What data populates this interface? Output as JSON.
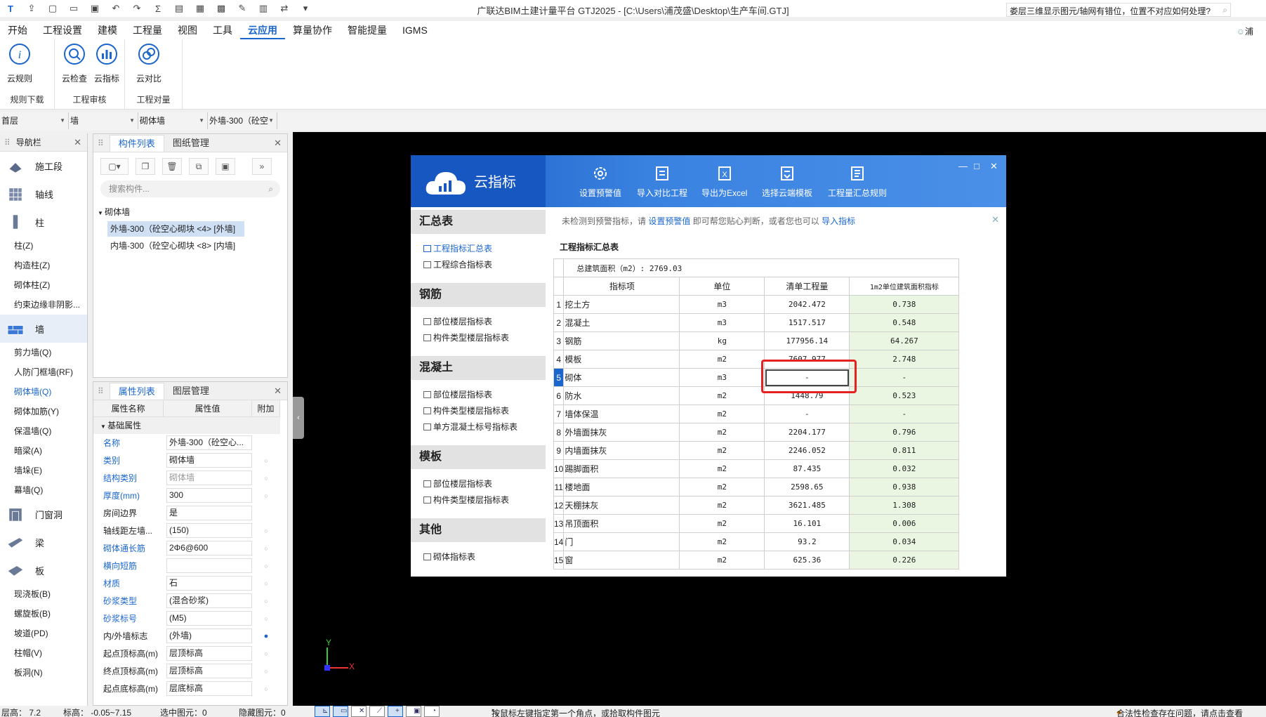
{
  "window": {
    "title": "广联达BIM土建计量平台 GTJ2025 - [C:\\Users\\浦茂盛\\Desktop\\生产车间.GTJ]"
  },
  "menu": {
    "items": [
      "开始",
      "工程设置",
      "建模",
      "工程量",
      "视图",
      "工具",
      "云应用",
      "算量协作",
      "智能提量",
      "IGMS"
    ],
    "active": "云应用",
    "help_search": "娄层三维显示图元/轴网有错位，位置不对应如何处理?",
    "user": "浦"
  },
  "ribbon": {
    "groups": [
      {
        "title": "规则下载",
        "buttons": [
          "云规则"
        ]
      },
      {
        "title": "工程审核",
        "buttons": [
          "云检查",
          "云指标"
        ]
      },
      {
        "title": "工程对量",
        "buttons": [
          "云对比"
        ]
      }
    ]
  },
  "selectors": [
    "首层",
    "墙",
    "砌体墙",
    "外墙-300（砼空"
  ],
  "nav": {
    "title": "导航栏",
    "entries": [
      {
        "type": "cat",
        "label": "施工段"
      },
      {
        "type": "cat",
        "label": "轴线"
      },
      {
        "type": "cat",
        "label": "柱"
      },
      {
        "type": "sub",
        "label": "柱(Z)"
      },
      {
        "type": "sub",
        "label": "构造柱(Z)"
      },
      {
        "type": "sub",
        "label": "砌体柱(Z)"
      },
      {
        "type": "sub",
        "label": "约束边缘非阴影..."
      },
      {
        "type": "cat",
        "label": "墙",
        "highlight": true
      },
      {
        "type": "sub",
        "label": "剪力墙(Q)"
      },
      {
        "type": "sub",
        "label": "人防门框墙(RF)"
      },
      {
        "type": "sub",
        "label": "砌体墙(Q)",
        "selected": true
      },
      {
        "type": "sub",
        "label": "砌体加筋(Y)"
      },
      {
        "type": "sub",
        "label": "保温墙(Q)"
      },
      {
        "type": "sub",
        "label": "暗梁(A)"
      },
      {
        "type": "sub",
        "label": "墙垛(E)"
      },
      {
        "type": "sub",
        "label": "幕墙(Q)"
      },
      {
        "type": "cat",
        "label": "门窗洞"
      },
      {
        "type": "cat",
        "label": "梁"
      },
      {
        "type": "cat",
        "label": "板"
      },
      {
        "type": "sub",
        "label": "现浇板(B)"
      },
      {
        "type": "sub",
        "label": "螺旋板(B)"
      },
      {
        "type": "sub",
        "label": "坡道(PD)"
      },
      {
        "type": "sub",
        "label": "柱帽(V)"
      },
      {
        "type": "sub",
        "label": "板洞(N)"
      }
    ]
  },
  "component_panel": {
    "tabs": [
      "构件列表",
      "图纸管理"
    ],
    "search_placeholder": "搜索构件...",
    "group": "砌体墙",
    "items": [
      {
        "label": "外墙-300（砼空心砌块 <4> [外墙]",
        "selected": true
      },
      {
        "label": "内墙-300（砼空心砌块 <8> [内墙]",
        "selected": false
      }
    ]
  },
  "property_panel": {
    "tabs": [
      "属性列表",
      "图层管理"
    ],
    "headers": [
      "属性名称",
      "属性值",
      "附加"
    ],
    "section": "基础属性",
    "rows": [
      {
        "name": "名称",
        "value": "外墙-300（砼空心...",
        "blue": true,
        "grey": false,
        "add": ""
      },
      {
        "name": "类别",
        "value": "砌体墙",
        "blue": true,
        "grey": false,
        "add": "circle"
      },
      {
        "name": "结构类别",
        "value": "砌体墙",
        "blue": true,
        "grey": true,
        "add": "circle"
      },
      {
        "name": "厚度(mm)",
        "value": "300",
        "blue": true,
        "grey": false,
        "add": "circle"
      },
      {
        "name": "房间边界",
        "value": "是",
        "blue": false,
        "grey": false,
        "add": ""
      },
      {
        "name": "轴线距左墙...",
        "value": "(150)",
        "blue": false,
        "grey": false,
        "add": "circle"
      },
      {
        "name": "砌体通长筋",
        "value": "2Φ6@600",
        "blue": true,
        "grey": false,
        "add": "circle"
      },
      {
        "name": "横向短筋",
        "value": "",
        "blue": true,
        "grey": false,
        "add": "circle"
      },
      {
        "name": "材质",
        "value": "石",
        "blue": true,
        "grey": false,
        "add": "circle"
      },
      {
        "name": "砂浆类型",
        "value": "(混合砂浆)",
        "blue": true,
        "grey": false,
        "add": "circle"
      },
      {
        "name": "砂浆标号",
        "value": "(M5)",
        "blue": true,
        "grey": false,
        "add": "circle"
      },
      {
        "name": "内/外墙标志",
        "value": "(外墙)",
        "blue": false,
        "grey": false,
        "add": "dot"
      },
      {
        "name": "起点顶标高(m)",
        "value": "层顶标高",
        "blue": false,
        "grey": false,
        "add": "circle"
      },
      {
        "name": "终点顶标高(m)",
        "value": "层顶标高",
        "blue": false,
        "grey": false,
        "add": "circle"
      },
      {
        "name": "起点底标高(m)",
        "value": "层底标高",
        "blue": false,
        "grey": false,
        "add": "circle"
      }
    ]
  },
  "dialog": {
    "brand": "云指标",
    "tools": [
      "设置预警值",
      "导入对比工程",
      "导出为Excel",
      "选择云端模板",
      "工程量汇总规则"
    ],
    "notice": {
      "prefix": "未检测到预警指标，请",
      "link1": "设置预警值",
      "middle": "即可帮您贴心判断，或者您也可以",
      "link2": "导入指标"
    },
    "sidebar": [
      {
        "title": "汇总表",
        "items": [
          {
            "label": "工程指标汇总表",
            "active": true
          },
          {
            "label": "工程综合指标表",
            "active": false
          }
        ]
      },
      {
        "title": "钢筋",
        "items": [
          {
            "label": "部位楼层指标表",
            "active": false
          },
          {
            "label": "构件类型楼层指标表",
            "active": false
          }
        ]
      },
      {
        "title": "混凝土",
        "items": [
          {
            "label": "部位楼层指标表",
            "active": false
          },
          {
            "label": "构件类型楼层指标表",
            "active": false
          },
          {
            "label": "单方混凝土标号指标表",
            "active": false
          }
        ]
      },
      {
        "title": "模板",
        "items": [
          {
            "label": "部位楼层指标表",
            "active": false
          },
          {
            "label": "构件类型楼层指标表",
            "active": false
          }
        ]
      },
      {
        "title": "其他",
        "items": [
          {
            "label": "砌体指标表",
            "active": false
          }
        ]
      }
    ],
    "table": {
      "title": "工程指标汇总表",
      "total": "总建筑面积（m2）: 2769.03",
      "headers": [
        "指标项",
        "单位",
        "清单工程量",
        "1m2单位建筑面积指标"
      ],
      "selected_row": 5,
      "rows": [
        [
          "1",
          "挖土方",
          "m3",
          "2042.472",
          "0.738"
        ],
        [
          "2",
          "混凝土",
          "m3",
          "1517.517",
          "0.548"
        ],
        [
          "3",
          "钢筋",
          "kg",
          "177956.14",
          "64.267"
        ],
        [
          "4",
          "模板",
          "m2",
          "7607.977",
          "2.748"
        ],
        [
          "5",
          "砌体",
          "m3",
          "-",
          "-"
        ],
        [
          "6",
          "防水",
          "m2",
          "1448.79",
          "0.523"
        ],
        [
          "7",
          "墙体保温",
          "m2",
          "-",
          "-"
        ],
        [
          "8",
          "外墙面抹灰",
          "m2",
          "2204.177",
          "0.796"
        ],
        [
          "9",
          "内墙面抹灰",
          "m2",
          "2246.052",
          "0.811"
        ],
        [
          "10",
          "踢脚面积",
          "m2",
          "87.435",
          "0.032"
        ],
        [
          "11",
          "楼地面",
          "m2",
          "2598.65",
          "0.938"
        ],
        [
          "12",
          "天棚抹灰",
          "m2",
          "3621.485",
          "1.308"
        ],
        [
          "13",
          "吊顶面积",
          "m2",
          "16.101",
          "0.006"
        ],
        [
          "14",
          "门",
          "m2",
          "93.2",
          "0.034"
        ],
        [
          "15",
          "窗",
          "m2",
          "625.36",
          "0.226"
        ]
      ]
    }
  },
  "statusbar": {
    "floor_height": "层高：  7.2",
    "elevation": "标高：  -0.05~7.15",
    "selected": "选中图元：0",
    "hidden": "隐藏图元：0",
    "hint": "按鼠标左键指定第一个角点，或拾取构件图元",
    "warning": "合法性检查存在问题，请点击查看"
  },
  "axis": {
    "x": "X",
    "y": "Y"
  },
  "colors": {
    "accent": "#1a66cc",
    "dialog_header": "#1757c2",
    "highlight_box": "#e52222",
    "index_cell": "#eaf6e2"
  }
}
